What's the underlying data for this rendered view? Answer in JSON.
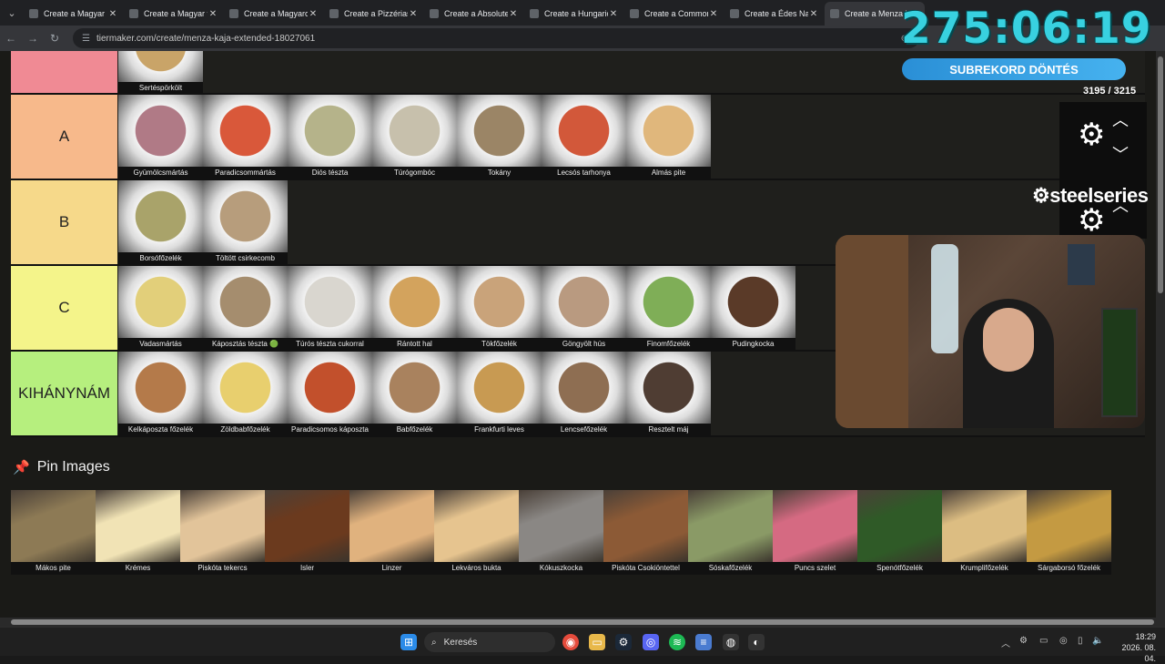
{
  "tabs": [
    {
      "title": "Create a Magyar k",
      "active": false
    },
    {
      "title": "Create a Magyar t",
      "active": false
    },
    {
      "title": "Create a Magyarc",
      "active": false
    },
    {
      "title": "Create a Pizzérias",
      "active": false
    },
    {
      "title": "Create a Absolute",
      "active": false
    },
    {
      "title": "Create a Hungaric",
      "active": false
    },
    {
      "title": "Create a Common",
      "active": false
    },
    {
      "title": "Create a Édes Na",
      "active": false
    },
    {
      "title": "Create a Menza k",
      "active": true
    }
  ],
  "address": {
    "url": "tiermaker.com/create/menza-kaja-extended-18027061"
  },
  "tiers": [
    {
      "label": "",
      "color": "#f08a94",
      "items": [
        {
          "name": "Sertéspörkölt",
          "color": "#c9a468"
        }
      ]
    },
    {
      "label": "A",
      "color": "#f7b98b",
      "items": [
        {
          "name": "Gyümölcsmártás",
          "color": "#b07a86"
        },
        {
          "name": "Paradicsommártás",
          "color": "#d9583a"
        },
        {
          "name": "Diós tészta",
          "color": "#b5b38a"
        },
        {
          "name": "Túrógombóc",
          "color": "#c7c0ac"
        },
        {
          "name": "Tokány",
          "color": "#9b8566"
        },
        {
          "name": "Lecsós tarhonya",
          "color": "#d2583a"
        },
        {
          "name": "Almás pite",
          "color": "#e0b77c"
        }
      ]
    },
    {
      "label": "B",
      "color": "#f6d98a",
      "items": [
        {
          "name": "Borsófőzelék",
          "color": "#a9a36a"
        },
        {
          "name": "Töltött csirkecomb",
          "color": "#b79d7c"
        }
      ]
    },
    {
      "label": "C",
      "color": "#f4f48a",
      "items": [
        {
          "name": "Vadasmártás",
          "color": "#e2cf7a"
        },
        {
          "name": "Káposztás tészta 🟢",
          "color": "#a58d6e"
        },
        {
          "name": "Túrós tészta cukorral",
          "color": "#d9d6cf"
        },
        {
          "name": "Rántott hal",
          "color": "#d3a35d"
        },
        {
          "name": "Tökfőzelék",
          "color": "#c9a37a"
        },
        {
          "name": "Göngyölt hús",
          "color": "#b99a80"
        },
        {
          "name": "Finomfőzelék",
          "color": "#7fae57"
        },
        {
          "name": "Pudingkocka",
          "color": "#5a3a28"
        }
      ]
    },
    {
      "label": "KIHÁNYNÁM",
      "color": "#b6ef7e",
      "items": [
        {
          "name": "Kelkáposzta főzelék",
          "color": "#b47a4a"
        },
        {
          "name": "Zöldbabfőzelék",
          "color": "#e8cf6e"
        },
        {
          "name": "Paradicsomos káposzta",
          "color": "#c2502c"
        },
        {
          "name": "Babfőzelék",
          "color": "#a9825e"
        },
        {
          "name": "Frankfurti leves",
          "color": "#c89a52"
        },
        {
          "name": "Lencsefőzelék",
          "color": "#8e6e52"
        },
        {
          "name": "Resztelt máj",
          "color": "#4f3d33"
        }
      ]
    }
  ],
  "pin": {
    "title": "Pin Images",
    "items": [
      {
        "name": "Mákos pite",
        "color": "#8d7a55"
      },
      {
        "name": "Krémes",
        "color": "#f1e3b5"
      },
      {
        "name": "Piskóta tekercs",
        "color": "#e2c49a"
      },
      {
        "name": "Isler",
        "color": "#6b3a1e"
      },
      {
        "name": "Linzer",
        "color": "#e0b27e"
      },
      {
        "name": "Lekváros bukta",
        "color": "#e6c48f"
      },
      {
        "name": "Kókuszkocka",
        "color": "#8a8784"
      },
      {
        "name": "Piskóta Csokiöntettel",
        "color": "#8c5a36"
      },
      {
        "name": "Sóskafőzelék",
        "color": "#8a9a66"
      },
      {
        "name": "Puncs szelet",
        "color": "#d56a82"
      },
      {
        "name": "Spenótfőzelék",
        "color": "#2f5a27"
      },
      {
        "name": "Krumplifőzelék",
        "color": "#dcbd82"
      },
      {
        "name": "Sárgaborsó főzelék",
        "color": "#c49a42"
      }
    ]
  },
  "overlay": {
    "timer": "275:06:19",
    "button": "SUBREKORD DÖNTÉS",
    "count": "3195 / 3215",
    "brand": "steelseries"
  },
  "taskbar": {
    "search": "Keresés",
    "time": "18:29",
    "date": "2026. 08. 04."
  }
}
